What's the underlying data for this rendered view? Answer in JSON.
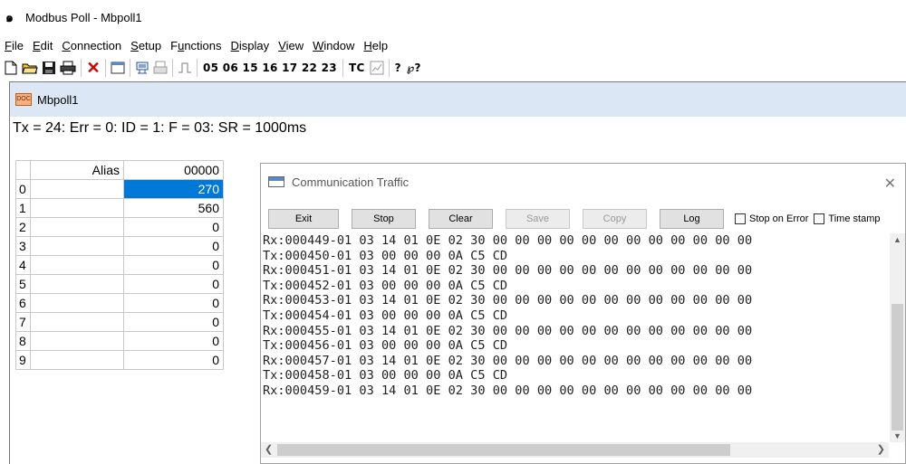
{
  "app": {
    "title": "Modbus Poll - Mbpoll1"
  },
  "menu": [
    {
      "label": "File",
      "u": "F",
      "rest": "ile"
    },
    {
      "label": "Edit",
      "u": "E",
      "rest": "dit"
    },
    {
      "label": "Connection",
      "u": "C",
      "rest": "onnection"
    },
    {
      "label": "Setup",
      "u": "S",
      "rest": "etup"
    },
    {
      "label": "Functions",
      "pre": "F",
      "u": "u",
      "rest": "nctions"
    },
    {
      "label": "Display",
      "u": "D",
      "rest": "isplay"
    },
    {
      "label": "View",
      "u": "V",
      "rest": "iew"
    },
    {
      "label": "Window",
      "u": "W",
      "rest": "indow"
    },
    {
      "label": "Help",
      "u": "H",
      "rest": "elp"
    }
  ],
  "toolbar": {
    "function_codes": "05 06 15 16 17 22 23",
    "tc_label": "TC",
    "help_glyph": "?",
    "context_help_glyph": "℘?"
  },
  "mdi": {
    "title": "Mbpoll1",
    "doc_icon_text": "DOC",
    "status": "Tx = 24: Err = 0: ID = 1: F = 03: SR = 1000ms"
  },
  "grid": {
    "headers": {
      "alias": "Alias",
      "address": "00000"
    },
    "rows": [
      {
        "n": "0",
        "alias": "",
        "value": "270"
      },
      {
        "n": "1",
        "alias": "",
        "value": "560"
      },
      {
        "n": "2",
        "alias": "",
        "value": "0"
      },
      {
        "n": "3",
        "alias": "",
        "value": "0"
      },
      {
        "n": "4",
        "alias": "",
        "value": "0"
      },
      {
        "n": "5",
        "alias": "",
        "value": "0"
      },
      {
        "n": "6",
        "alias": "",
        "value": "0"
      },
      {
        "n": "7",
        "alias": "",
        "value": "0"
      },
      {
        "n": "8",
        "alias": "",
        "value": "0"
      },
      {
        "n": "9",
        "alias": "",
        "value": "0"
      }
    ]
  },
  "traffic": {
    "title": "Communication Traffic",
    "buttons": {
      "exit": "Exit",
      "stop": "Stop",
      "clear": "Clear",
      "save": "Save",
      "copy": "Copy",
      "log": "Log"
    },
    "checkboxes": {
      "stop_on_error": "Stop on Error",
      "time_stamp": "Time stamp"
    },
    "lines": [
      "Rx:000449-01 03 14 01 0E 02 30 00 00 00 00 00 00 00 00 00 00 00 00",
      "Tx:000450-01 03 00 00 00 0A C5 CD",
      "Rx:000451-01 03 14 01 0E 02 30 00 00 00 00 00 00 00 00 00 00 00 00",
      "Tx:000452-01 03 00 00 00 0A C5 CD",
      "Rx:000453-01 03 14 01 0E 02 30 00 00 00 00 00 00 00 00 00 00 00 00",
      "Tx:000454-01 03 00 00 00 0A C5 CD",
      "Rx:000455-01 03 14 01 0E 02 30 00 00 00 00 00 00 00 00 00 00 00 00",
      "Tx:000456-01 03 00 00 00 0A C5 CD",
      "Rx:000457-01 03 14 01 0E 02 30 00 00 00 00 00 00 00 00 00 00 00 00",
      "Tx:000458-01 03 00 00 00 0A C5 CD",
      "Rx:000459-01 03 14 01 0E 02 30 00 00 00 00 00 00 00 00 00 00 00 00"
    ]
  }
}
